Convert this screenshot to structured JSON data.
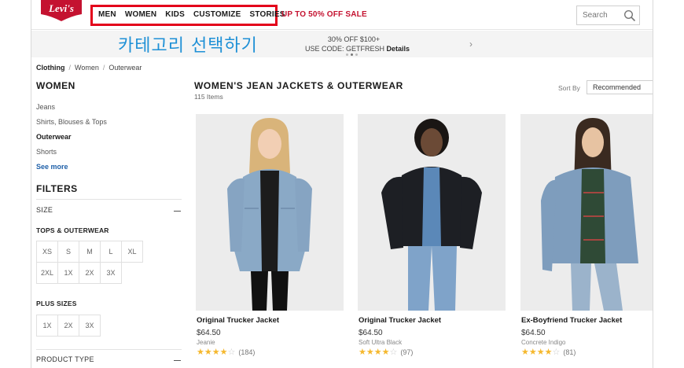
{
  "header": {
    "logo_text": "Levi's",
    "nav": [
      "MEN",
      "WOMEN",
      "KIDS",
      "CUSTOMIZE",
      "STORIES"
    ],
    "sale": "UP TO 50% OFF SALE",
    "search_placeholder": "Search"
  },
  "annotation": {
    "korean_label": "카테고리 선택하기"
  },
  "promo": {
    "line1": "30% OFF $100+",
    "line2_prefix": "USE CODE: GETFRESH",
    "line2_link": "Details",
    "arrow": "›"
  },
  "breadcrumb": {
    "items": [
      "Clothing",
      "Women",
      "Outerwear"
    ],
    "separator": "/"
  },
  "sidebar": {
    "title": "WOMEN",
    "links": [
      "Jeans",
      "Shirts, Blouses & Tops",
      "Outerwear",
      "Shorts"
    ],
    "active_link": "Outerwear",
    "see_more": "See more",
    "filters_title": "FILTERS",
    "size_label": "SIZE",
    "tops_label": "TOPS & OUTERWEAR",
    "tops_sizes": [
      "XS",
      "S",
      "M",
      "L",
      "XL",
      "2XL",
      "1X",
      "2X",
      "3X"
    ],
    "plus_label": "PLUS SIZES",
    "plus_sizes": [
      "1X",
      "2X",
      "3X"
    ],
    "product_type_label": "PRODUCT TYPE"
  },
  "listing": {
    "title": "WOMEN'S JEAN JACKETS & OUTERWEAR",
    "count": "115 Items",
    "sort_label": "Sort By",
    "sort_value": "Recommended"
  },
  "products": [
    {
      "name": "Original Trucker Jacket",
      "price": "$64.50",
      "variant": "Jeanie",
      "rating": 4.5,
      "reviews": "(184)"
    },
    {
      "name": "Original Trucker Jacket",
      "price": "$64.50",
      "variant": "Soft Ultra Black",
      "rating": 4.5,
      "reviews": "(97)"
    },
    {
      "name": "Ex-Boyfriend Trucker Jacket",
      "price": "$64.50",
      "variant": "Concrete Indigo",
      "rating": 4.5,
      "reviews": "(81)"
    }
  ],
  "colors": {
    "brand_red": "#c41230",
    "highlight_red": "#e3001b",
    "annotation_blue": "#1e90d6",
    "star": "#f5b82e",
    "link_blue": "#1e5fa8"
  }
}
